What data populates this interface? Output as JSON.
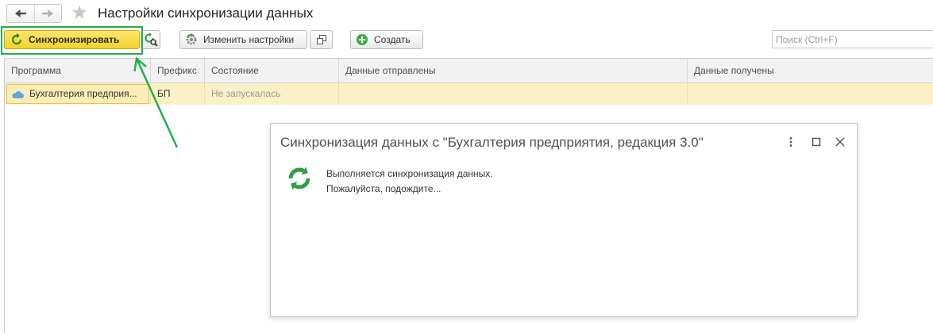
{
  "window": {
    "title": "Настройки синхронизации данных"
  },
  "nav": {
    "back_icon": "arrow-left-icon",
    "forward_icon": "arrow-right-icon",
    "favorite_icon": "star-icon"
  },
  "toolbar": {
    "sync_button": {
      "label": "Синхронизировать",
      "icon": "sync-icon"
    },
    "sync_find_button": {
      "icon": "sync-search-icon"
    },
    "change_settings_button": {
      "label": "Изменить настройки",
      "icon": "settings-sync-icon"
    },
    "copy_button": {
      "icon": "copy-icon"
    },
    "create_button": {
      "label": "Создать",
      "icon": "add-circle-icon"
    },
    "search": {
      "placeholder": "Поиск (Ctrl+F)",
      "value": ""
    }
  },
  "table": {
    "columns": [
      "Программа",
      "Префикс",
      "Состояние",
      "Данные отправлены",
      "Данные получены"
    ],
    "rows": [
      {
        "icon": "cloud-icon",
        "program": "Бухгалтерия предприя...",
        "prefix": "БП",
        "state": "Не запускалась",
        "sent": "",
        "received": "",
        "selected": true
      }
    ]
  },
  "dialog": {
    "title": "Синхронизация данных с \"Бухгалтерия предприятия, редакция 3.0\"",
    "icon": "sync-progress-icon",
    "message": [
      "Выполняется синхронизация данных.",
      "Пожалуйста, подождите..."
    ],
    "controls": {
      "menu_icon": "more-vertical-icon",
      "maximize_icon": "maximize-icon",
      "close_icon": "close-icon"
    }
  },
  "colors": {
    "default_button": "#f4d12a",
    "selected_row": "#fbf1c6",
    "annotation": "#27ae4d",
    "sync_green": "#2f9e44",
    "cloud_blue": "#5fa4e6"
  }
}
